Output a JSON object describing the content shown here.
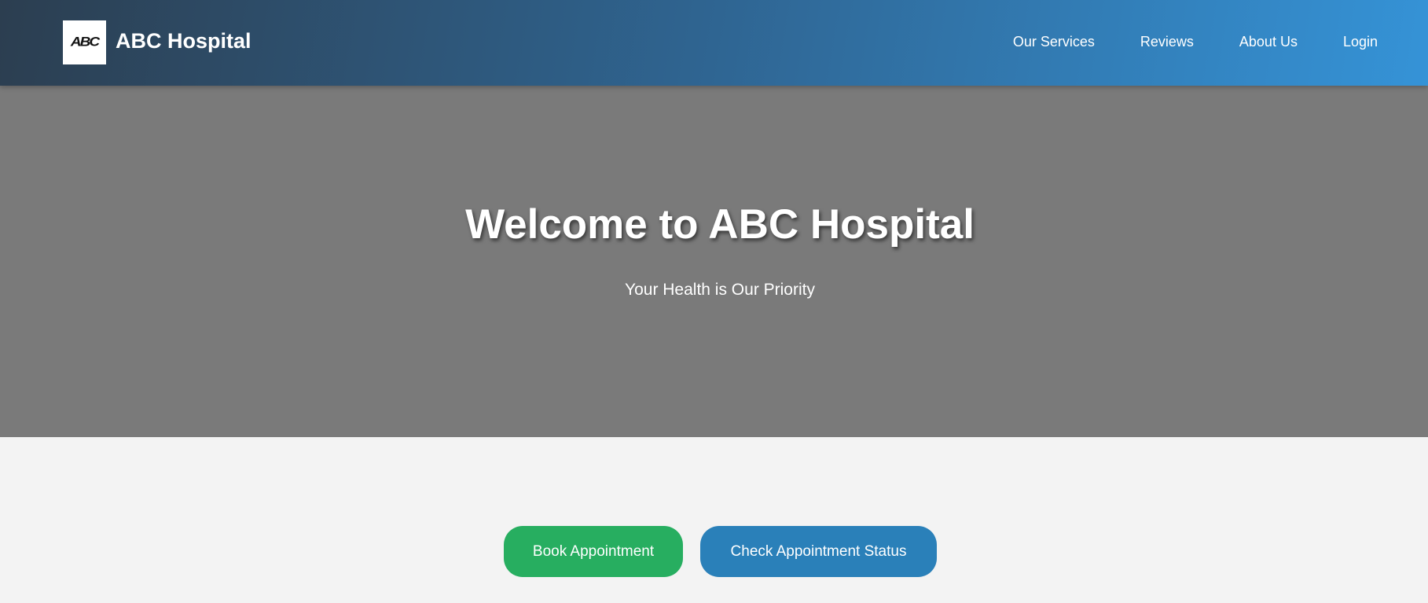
{
  "header": {
    "logo_text": "ABC",
    "brand": "ABC Hospital",
    "nav": [
      {
        "label": "Our Services"
      },
      {
        "label": "Reviews"
      },
      {
        "label": "About Us"
      },
      {
        "label": "Login"
      }
    ]
  },
  "hero": {
    "title": "Welcome to ABC Hospital",
    "subtitle": "Your Health is Our Priority"
  },
  "actions": {
    "book_label": "Book Appointment",
    "status_label": "Check Appointment Status"
  },
  "colors": {
    "header_gradient_start": "#2c3e50",
    "header_gradient_end": "#3593d7",
    "hero_bg": "#7a7a7a",
    "page_bg": "#f3f3f3",
    "book_button": "#27ae60",
    "status_button": "#2a80b9"
  }
}
